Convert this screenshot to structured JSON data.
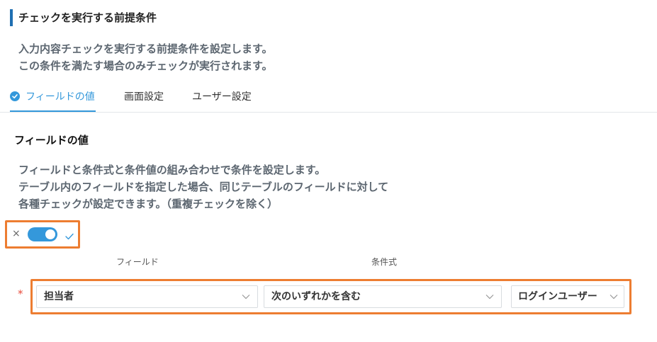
{
  "section": {
    "title": "チェックを実行する前提条件",
    "description_line1": "入力内容チェックを実行する前提条件を設定します。",
    "description_line2": "この条件を満たす場合のみチェックが実行されます。"
  },
  "tabs": [
    {
      "label": "フィールドの値",
      "active": true
    },
    {
      "label": "画面設定",
      "active": false
    },
    {
      "label": "ユーザー設定",
      "active": false
    }
  ],
  "field_value": {
    "title": "フィールドの値",
    "description_line1": "フィールドと条件式と条件値の組み合わせで条件を設定します。",
    "description_line2": "テーブル内のフィールドを指定した場合、同じテーブルのフィールドに対して",
    "description_line3": "各種チェックが設定できます。（重複チェックを除く）"
  },
  "toggle": {
    "off_symbol": "×",
    "on": true,
    "icons": {
      "off": "close-icon",
      "on": "check-icon"
    }
  },
  "columns": {
    "field_label": "フィールド",
    "operator_label": "条件式"
  },
  "condition": {
    "required_mark": "*",
    "field_value": "担当者",
    "operator_value": "次のいずれかを含む",
    "value_value": "ログインユーザー"
  },
  "colors": {
    "accent": "#3498db",
    "section_bar": "#1f6fb2",
    "highlight": "#ed7d31",
    "required": "#e74c3c"
  }
}
